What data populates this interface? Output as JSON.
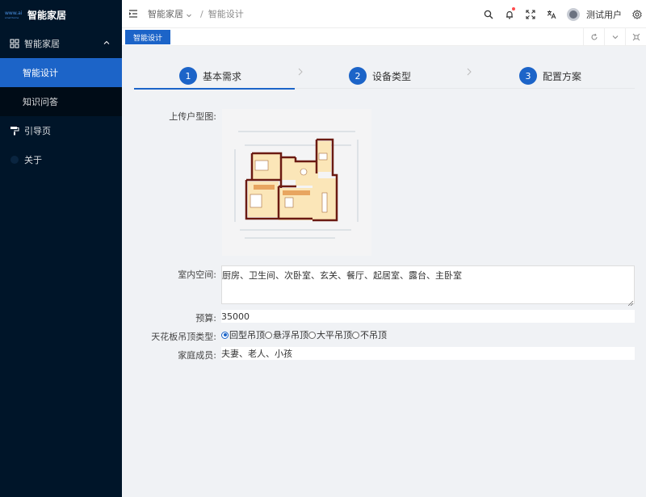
{
  "app": {
    "logo_small": "www.ai",
    "logo_tiny": "smarthome",
    "title": "智能家居"
  },
  "sidebar": {
    "group": {
      "label": "智能家居",
      "expanded": true
    },
    "sub_items": [
      {
        "label": "智能设计",
        "active": true
      },
      {
        "label": "知识问答",
        "active": false
      }
    ],
    "items": [
      {
        "label": "引导页",
        "icon": "paint-roller-icon"
      },
      {
        "label": "关于",
        "icon": "info-icon"
      }
    ]
  },
  "header": {
    "breadcrumb": [
      "智能家居",
      "智能设计"
    ],
    "separator": "/",
    "user_name": "测试用户"
  },
  "tabs": {
    "active": "智能设计"
  },
  "steps": [
    {
      "num": "1",
      "title": "基本需求",
      "active": true
    },
    {
      "num": "2",
      "title": "设备类型",
      "active": false
    },
    {
      "num": "3",
      "title": "配置方案",
      "active": false
    }
  ],
  "form": {
    "upload_label": "上传户型图:",
    "space_label": "室内空间:",
    "space_value": "厨房、卫生间、次卧室、玄关、餐厅、起居室、露台、主卧室",
    "budget_label": "预算:",
    "budget_value": "35000",
    "ceiling_label": "天花板吊顶类型:",
    "ceiling_options": [
      "回型吊顶",
      "悬浮吊顶",
      "大平吊顶",
      "不吊顶"
    ],
    "ceiling_selected": "回型吊顶",
    "family_label": "家庭成员:",
    "family_value": "夫妻、老人、小孩"
  },
  "colors": {
    "sidebar_bg": "#001529",
    "accent": "#1c64c8",
    "badge": "#ff4d4f"
  }
}
